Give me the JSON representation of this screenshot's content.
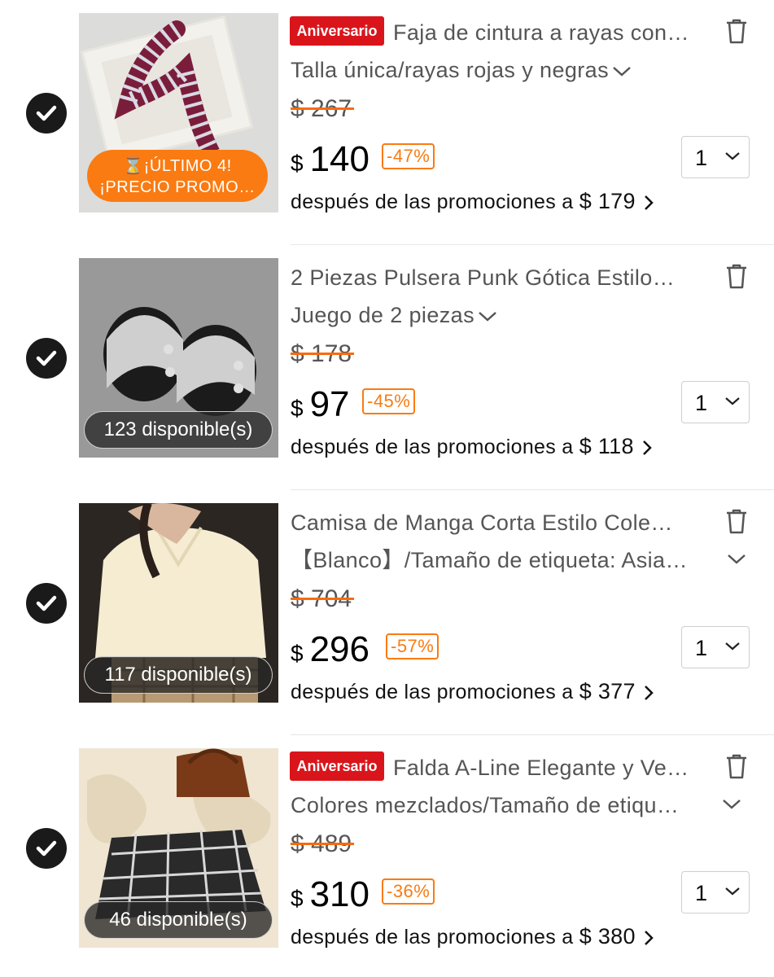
{
  "items": [
    {
      "badge": "Aniversario",
      "title": "Faja de cintura a rayas con…",
      "variant": "Talla única/rayas rojas y negras",
      "original_price": "$ 267",
      "currency": "$",
      "price": "140",
      "discount": "-47%",
      "quantity": "1",
      "after_promo_label": "después de las promociones a",
      "after_promo_price": "$ 179",
      "promo_line1": "⌛¡ÚLTIMO 4!",
      "promo_line2": "¡PRECIO PROMO…"
    },
    {
      "title": "2 Piezas Pulsera Punk Gótica Estilo…",
      "variant": "Juego de 2 piezas",
      "original_price": "$ 178",
      "currency": "$",
      "price": "97",
      "discount": "-45%",
      "quantity": "1",
      "after_promo_label": "después de las promociones a",
      "after_promo_price": "$ 118",
      "stock": "123 disponible(s)"
    },
    {
      "title": "Camisa de Manga Corta Estilo Cole…",
      "variant": "【Blanco】/Tamaño de etiqueta: Asia…",
      "original_price": "$ 704",
      "currency": "$",
      "price": "296",
      "discount": "-57%",
      "quantity": "1",
      "after_promo_label": "después de las promociones a",
      "after_promo_price": "$ 377",
      "stock": "117 disponible(s)"
    },
    {
      "badge": "Aniversario",
      "title": "Falda A-Line Elegante y Ve…",
      "variant": "Colores mezclados/Tamaño de etiqu…",
      "original_price": "$ 489",
      "currency": "$",
      "price": "310",
      "discount": "-36%",
      "quantity": "1",
      "after_promo_label": "después de las promociones a",
      "after_promo_price": "$ 380",
      "stock": "46 disponible(s)"
    }
  ],
  "icons": {
    "check": "checkmark-circle-icon",
    "trash": "trash-icon",
    "dropdown": "chevron-down-icon",
    "more": "chevron-right-icon"
  },
  "colors": {
    "accent_orange": "#fa7b12",
    "badge_red": "#d9151b",
    "check_fill": "#1a1a1a"
  }
}
